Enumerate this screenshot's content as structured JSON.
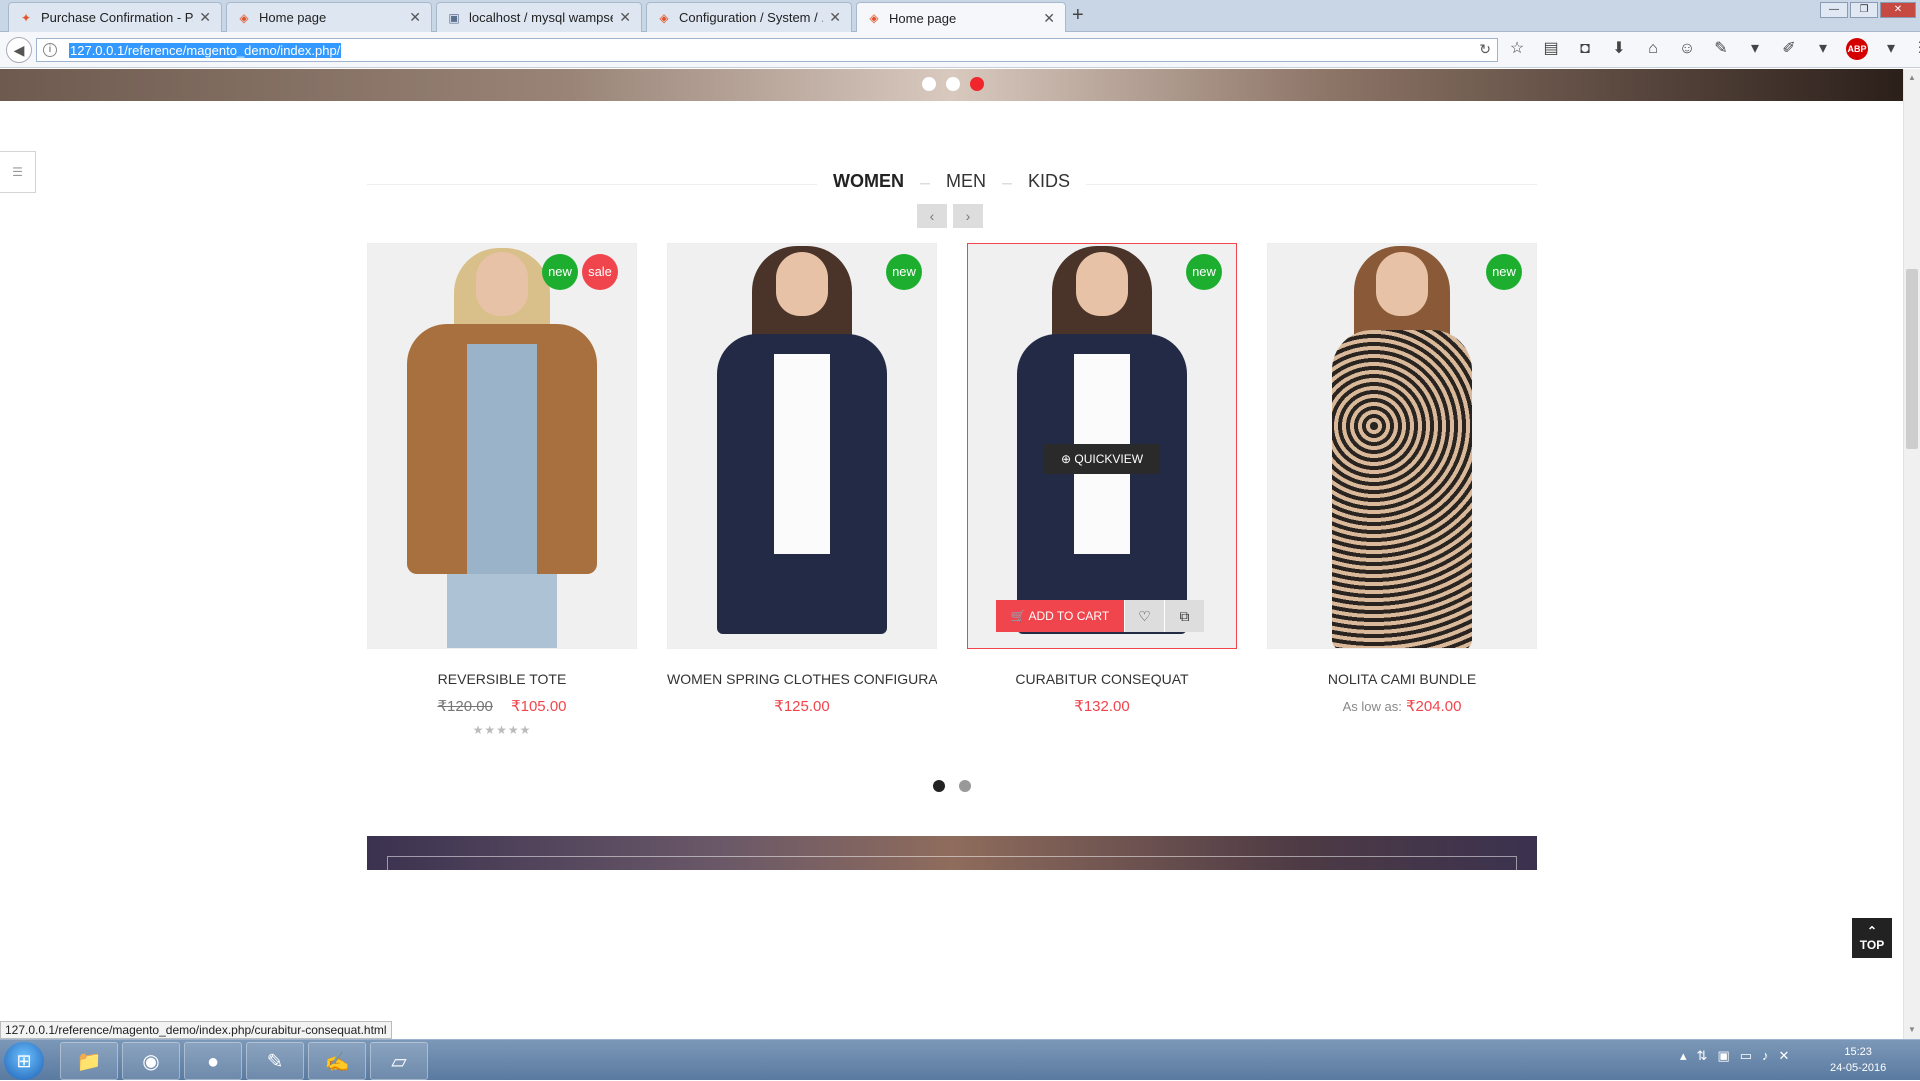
{
  "browser": {
    "tabs": [
      {
        "title": "Purchase Confirmation - P...",
        "icon": "ppc-icon"
      },
      {
        "title": "Home page",
        "icon": "magento-icon"
      },
      {
        "title": "localhost / mysql wampser...",
        "icon": "phpmyadmin-icon"
      },
      {
        "title": "Configuration / System / ...",
        "icon": "magento-icon"
      },
      {
        "title": "Home page",
        "icon": "magento-icon"
      }
    ],
    "url": "127.0.0.1/reference/magento_demo/index.php/",
    "status_url": "127.0.0.1/reference/magento_demo/index.php/curabitur-consequat.html"
  },
  "category_tabs": [
    "WOMEN",
    "MEN",
    "KIDS"
  ],
  "active_tab": "WOMEN",
  "products": [
    {
      "name": "REVERSIBLE TOTE",
      "old_price": "₹120.00",
      "price": "₹105.00",
      "badges": [
        "new",
        "sale"
      ],
      "rating_stars": "★★★★★"
    },
    {
      "name": "WOMEN SPRING CLOTHES CONFIGURA...",
      "price": "₹125.00",
      "badges": [
        "new"
      ]
    },
    {
      "name": "CURABITUR CONSEQUAT",
      "price": "₹132.00",
      "badges": [
        "new"
      ],
      "quickview": "QUICKVIEW",
      "add_to_cart": "ADD TO CART"
    },
    {
      "name": "NOLITA CAMI BUNDLE",
      "as_low_as": "As low as:",
      "price": "₹204.00",
      "badges": [
        "new"
      ]
    }
  ],
  "top_button": "TOP",
  "clock": {
    "time": "15:23",
    "date": "24-05-2016"
  },
  "colors": {
    "accent": "#f0454c",
    "badge_new": "#1dae2f",
    "badge_sale": "#f0454c"
  }
}
